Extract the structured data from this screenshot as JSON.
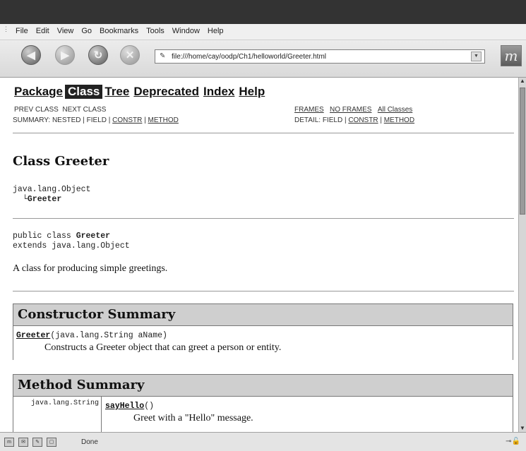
{
  "menu": [
    "File",
    "Edit",
    "View",
    "Go",
    "Bookmarks",
    "Tools",
    "Window",
    "Help"
  ],
  "toolbar": {
    "url": "file:///home/cay/oodp/Ch1/helloworld/Greeter.html"
  },
  "status": {
    "text": "Done"
  },
  "page": {
    "nav": {
      "package": "Package",
      "class": "Class",
      "tree": "Tree",
      "deprecated": "Deprecated",
      "index": "Index",
      "help": "Help"
    },
    "subnav": {
      "prev_class": "PREV CLASS",
      "next_class": "NEXT CLASS",
      "summary_prefix": "SUMMARY: NESTED | FIELD | ",
      "constr": "CONSTR",
      "sep": " | ",
      "method": "METHOD",
      "frames": "FRAMES",
      "no_frames": "NO FRAMES",
      "all_classes": "All Classes",
      "detail_prefix": "DETAIL: FIELD | "
    },
    "class_title": "Class Greeter",
    "hierarchy": {
      "parent": "java.lang.Object",
      "branch": "└",
      "child": "Greeter"
    },
    "declaration": {
      "line1_prefix": "public class ",
      "line1_name": "Greeter",
      "line2": "extends java.lang.Object"
    },
    "description": "A class for producing simple greetings.",
    "constructor_summary": {
      "title": "Constructor Summary",
      "name": "Greeter",
      "signature": "(java.lang.String aName)",
      "description": "Constructs a Greeter object that can greet a person or entity."
    },
    "method_summary": {
      "title": "Method Summary",
      "return_type": "java.lang.String",
      "name": "sayHello",
      "signature": "()",
      "description": "Greet with a \"Hello\" message."
    }
  }
}
